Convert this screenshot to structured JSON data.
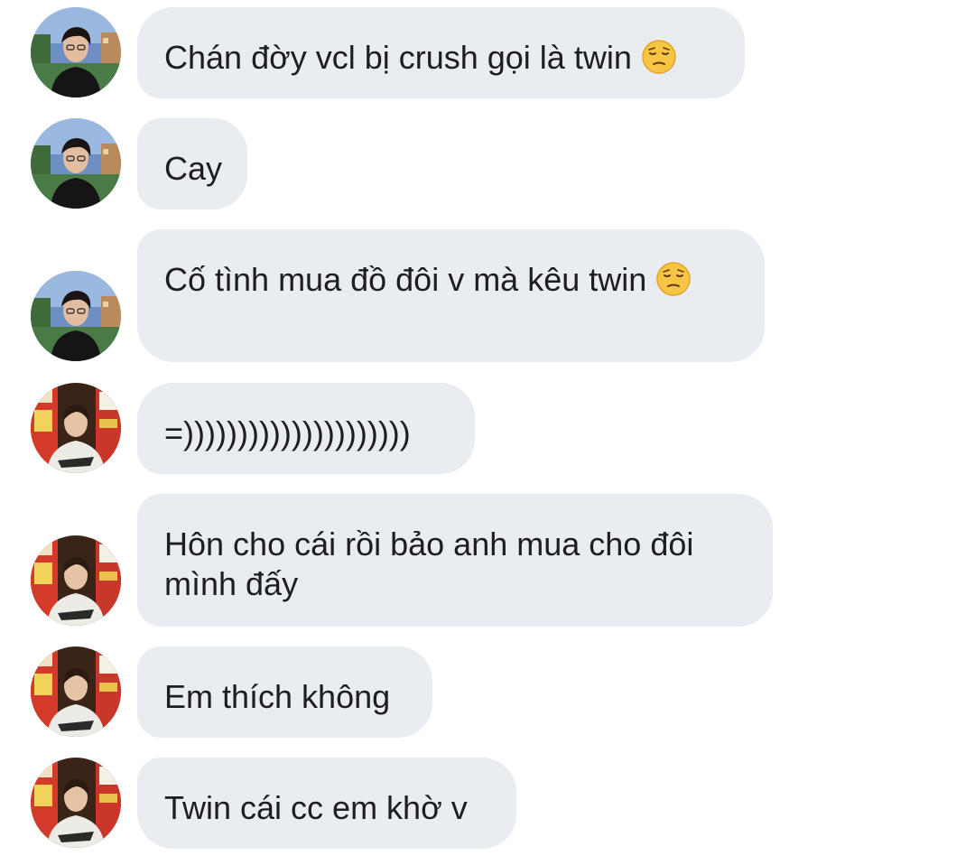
{
  "messages": [
    {
      "sender": "user_a",
      "text": "Chán đờy vcl bị crush gọi là twin",
      "emoji": "pensive-face"
    },
    {
      "sender": "user_a",
      "text": "Cay",
      "emoji": ""
    },
    {
      "sender": "user_a",
      "text": "Cố tình mua đồ đôi v mà kêu twin",
      "emoji": "pensive-face"
    },
    {
      "sender": "user_b",
      "text": "=)))))))))))))))))))))",
      "emoji": ""
    },
    {
      "sender": "user_b",
      "text": "Hôn cho cái rồi bảo anh mua cho đôi mình đấy",
      "emoji": ""
    },
    {
      "sender": "user_b",
      "text": "Em thích không",
      "emoji": ""
    },
    {
      "sender": "user_b",
      "text": "Twin cái cc em khờ v",
      "emoji": ""
    }
  ],
  "colors": {
    "bubble_bg": "#e9ecf0",
    "text": "#1c1e21",
    "background": "#ffffff",
    "emoji_face": "#f7c444"
  }
}
